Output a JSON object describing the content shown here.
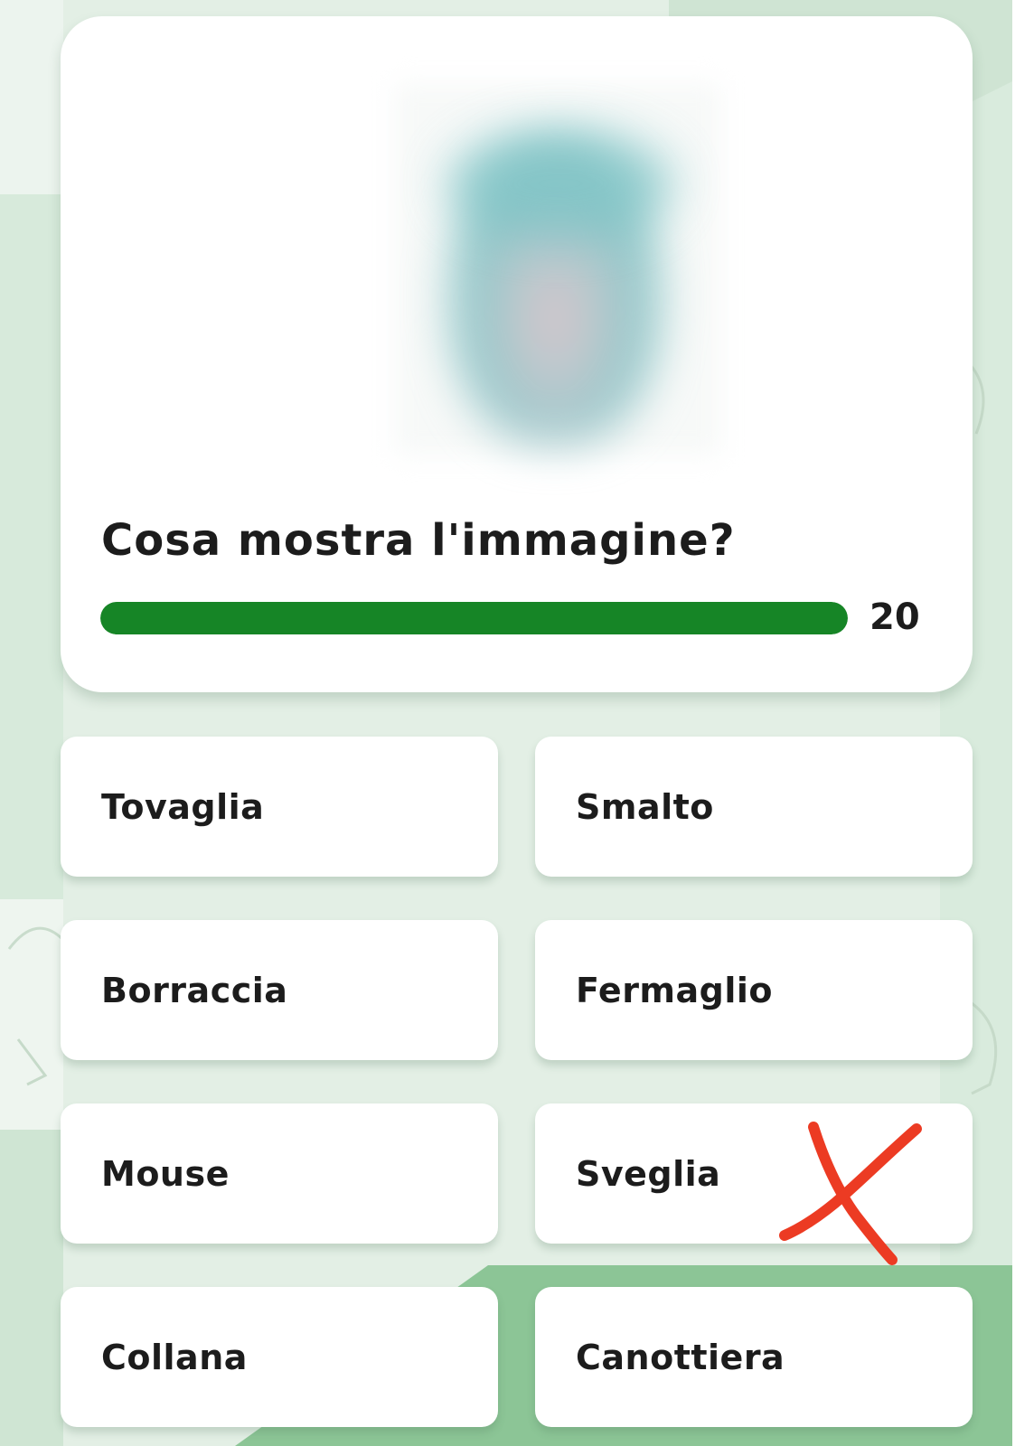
{
  "quiz": {
    "question": "Cosa mostra l'immagine?",
    "timer_value": "20",
    "timer_progress": 1.0,
    "image_description": "blurred-quiz-image"
  },
  "options": [
    {
      "label": "Tovaglia"
    },
    {
      "label": "Smalto"
    },
    {
      "label": "Borraccia"
    },
    {
      "label": "Fermaglio"
    },
    {
      "label": "Mouse"
    },
    {
      "label": "Sveglia",
      "marked_wrong": true
    },
    {
      "label": "Collana"
    },
    {
      "label": "Canottiera"
    }
  ],
  "colors": {
    "background": "#e3efe5",
    "card": "#ffffff",
    "timer_fill": "#168526",
    "text": "#1c1c1c",
    "cross_mark": "#ec3b23"
  },
  "icons": {
    "wrong_mark": "cross-icon"
  }
}
